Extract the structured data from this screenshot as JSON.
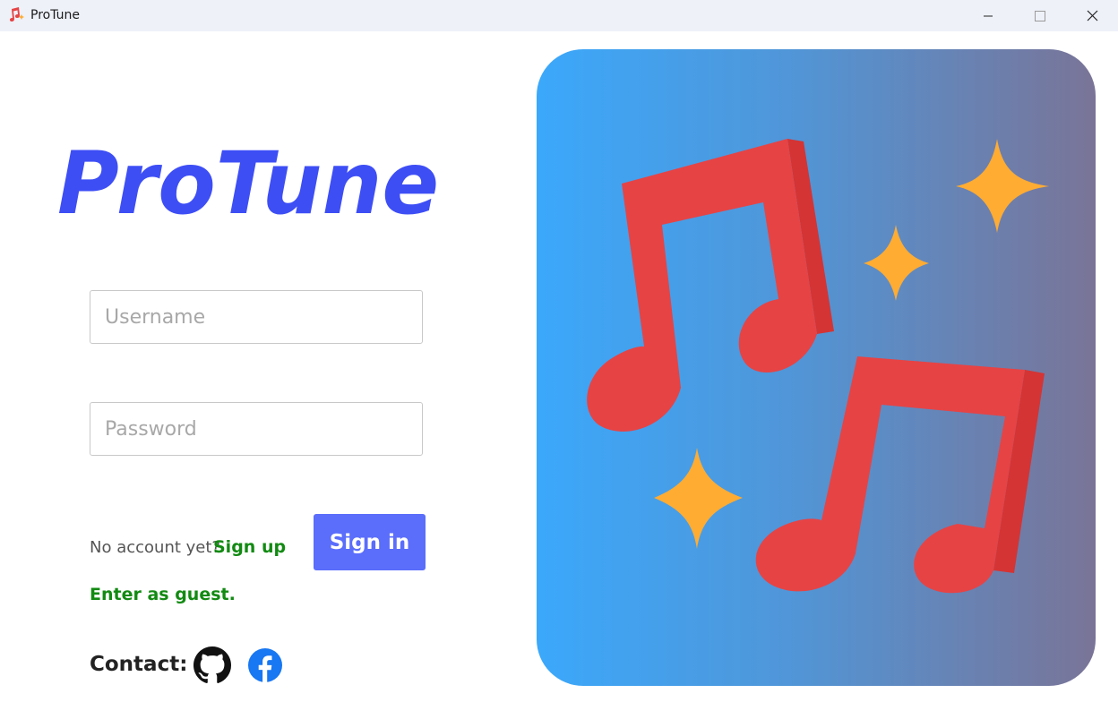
{
  "window": {
    "title": "ProTune",
    "icon": "music-note-app-icon",
    "controls": [
      "minimize",
      "maximize",
      "close"
    ]
  },
  "logo": {
    "text": "ProTune",
    "color": "#3d4ef5"
  },
  "form": {
    "username_placeholder": "Username",
    "password_placeholder": "Password",
    "no_account_text": "No account yet?",
    "signup_label": "Sign up",
    "signin_label": "Sign in",
    "guest_label": "Enter as guest."
  },
  "contact": {
    "label": "Contact:",
    "icons": [
      "github-icon",
      "facebook-icon"
    ]
  },
  "colors": {
    "accent": "#5a6dfb",
    "link": "#128a12",
    "panel_gradient": [
      "#3ba8fb",
      "#7a7497"
    ],
    "note": "#e64345",
    "sparkle": "#ffac33"
  }
}
